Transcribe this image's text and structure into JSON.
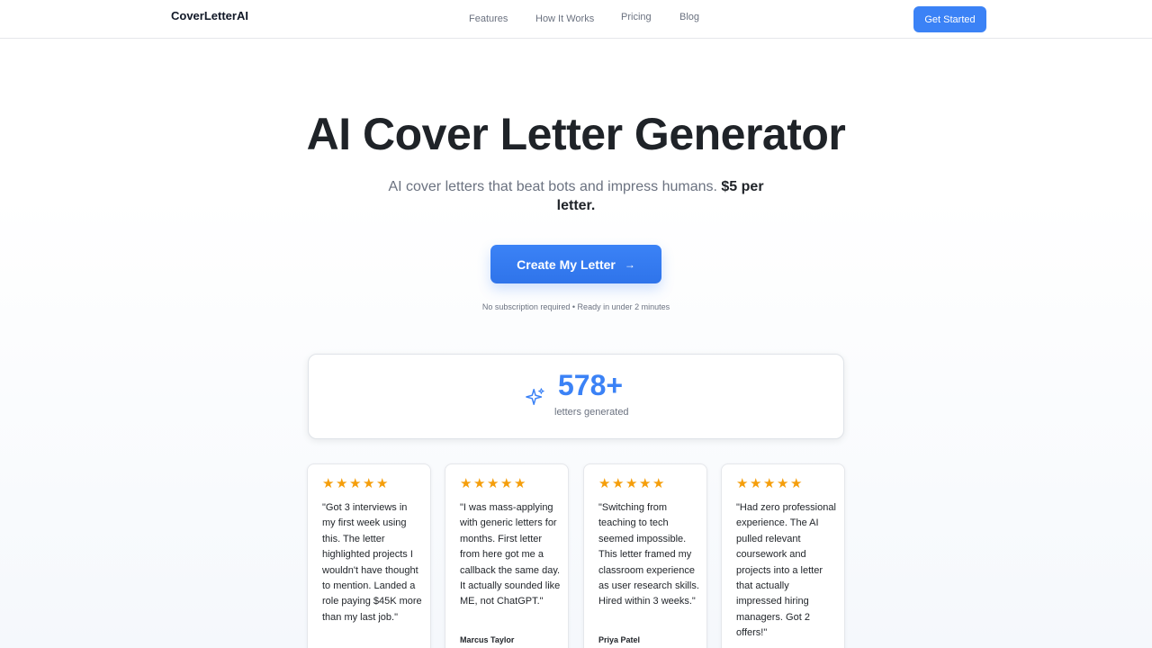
{
  "nav": {
    "brand": "CoverLetterAI",
    "links": [
      "Features",
      "How It Works",
      "Pricing",
      "Blog"
    ],
    "cta": "Get Started"
  },
  "hero": {
    "title": "AI Cover Letter Generator",
    "subtitle": "AI cover letters that beat bots and impress humans.",
    "price": "$5 per letter.",
    "cta": "Create My Letter",
    "cta_icon": "arrow-right-icon",
    "note": "No subscription required • Ready in under 2 minutes"
  },
  "stat": {
    "icon": "sparkle-icon",
    "number": "578+",
    "label": "letters generated"
  },
  "colors": {
    "accent": "#3b82f6",
    "star": "#f59e0b",
    "text": "#1f2328",
    "muted": "#6b7280"
  },
  "testimonials": [
    {
      "rating": 5,
      "quote": "\"Got 3 interviews in my first week using this. The letter highlighted projects I wouldn't have thought to mention. Landed a role paying $45K more than my last job.\"",
      "name": ""
    },
    {
      "rating": 5,
      "quote": "\"I was mass-applying with generic letters for months. First letter from here got me a callback the same day. It actually sounded like ME, not ChatGPT.\"",
      "name": "Marcus Taylor"
    },
    {
      "rating": 5,
      "quote": "\"Switching from teaching to tech seemed impossible. This letter framed my classroom experience as user research skills. Hired within 3 weeks.\"",
      "name": "Priya Patel"
    },
    {
      "rating": 5,
      "quote": "\"Had zero professional experience. The AI pulled relevant coursework and projects into a letter that actually impressed hiring managers. Got 2 offers!\"",
      "name": ""
    }
  ]
}
